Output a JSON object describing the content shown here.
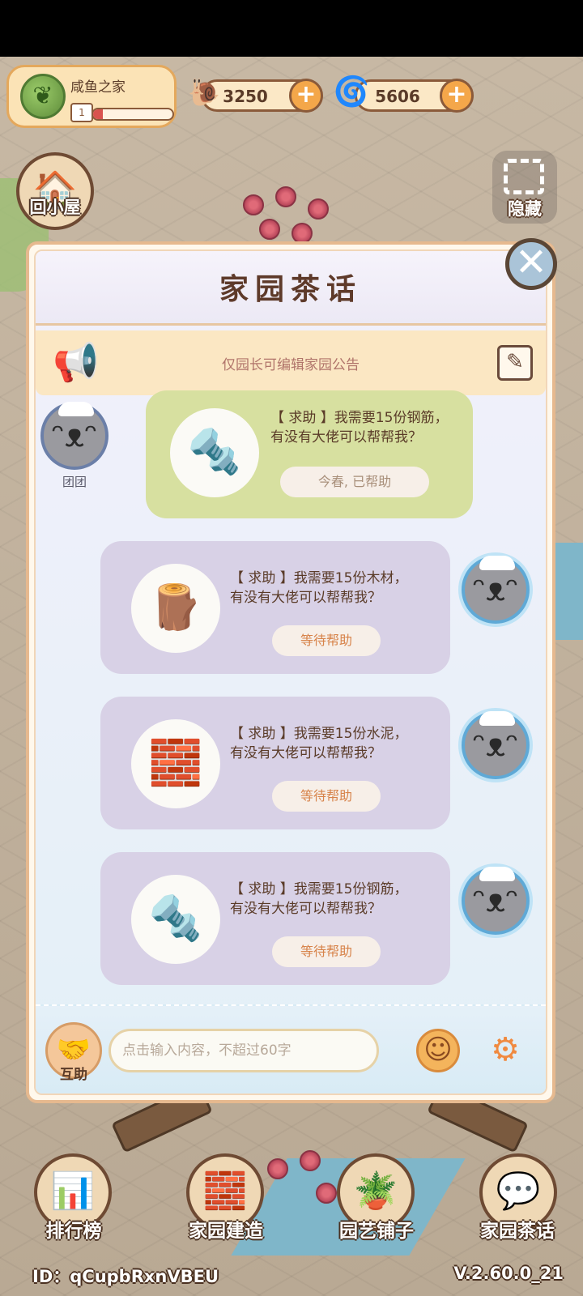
{
  "home": {
    "name": "咸鱼之家",
    "level": "1",
    "progress": 0.12
  },
  "currency": {
    "coins": "3250",
    "gems": "5606",
    "plus": "+"
  },
  "side": {
    "back_home_label": "回小屋",
    "hide_label": "隐藏"
  },
  "dialog": {
    "title": "家园茶话",
    "close": "✕",
    "notice": "仅园长可编辑家园公告"
  },
  "messages": [
    {
      "item_icon": "steel-bar-icon",
      "text": "【 求助 】我需要15份钢筋，\n有没有大佬可以帮帮我？",
      "status": "今春, 已帮助",
      "sender": "团团",
      "side": "left",
      "color": "#d7e0a0"
    },
    {
      "item_icon": "wood-log-icon",
      "text": "【 求助 】我需要15份木材，\n有没有大佬可以帮帮我？",
      "status": "等待帮助",
      "side": "right",
      "color": "#d8d1e6"
    },
    {
      "item_icon": "cement-bag-icon",
      "text": "【 求助 】我需要15份水泥，\n有没有大佬可以帮帮我？",
      "status": "等待帮助",
      "side": "right",
      "color": "#d8d1e6"
    },
    {
      "item_icon": "steel-bar-icon",
      "text": "【 求助 】我需要15份钢筋，\n有没有大佬可以帮帮我？",
      "status": "等待帮助",
      "side": "right",
      "color": "#d8d1e6"
    }
  ],
  "input": {
    "help_label": "互助",
    "placeholder": "点击输入内容，不超过60字"
  },
  "nav": [
    {
      "label": "排行榜",
      "icon": "leaderboard-icon"
    },
    {
      "label": "家园建造",
      "icon": "brick-build-icon"
    },
    {
      "label": "园艺铺子",
      "icon": "garden-shop-icon"
    },
    {
      "label": "家园茶话",
      "icon": "chat-bubbles-icon"
    }
  ],
  "footer": {
    "id": "ID：qCupbRxnVBEU",
    "version": "V.2.60.0_21"
  },
  "colors": {
    "accent": "#f4a74a",
    "dialog_border": "#e6b98f",
    "wait_text": "#d7834a"
  }
}
